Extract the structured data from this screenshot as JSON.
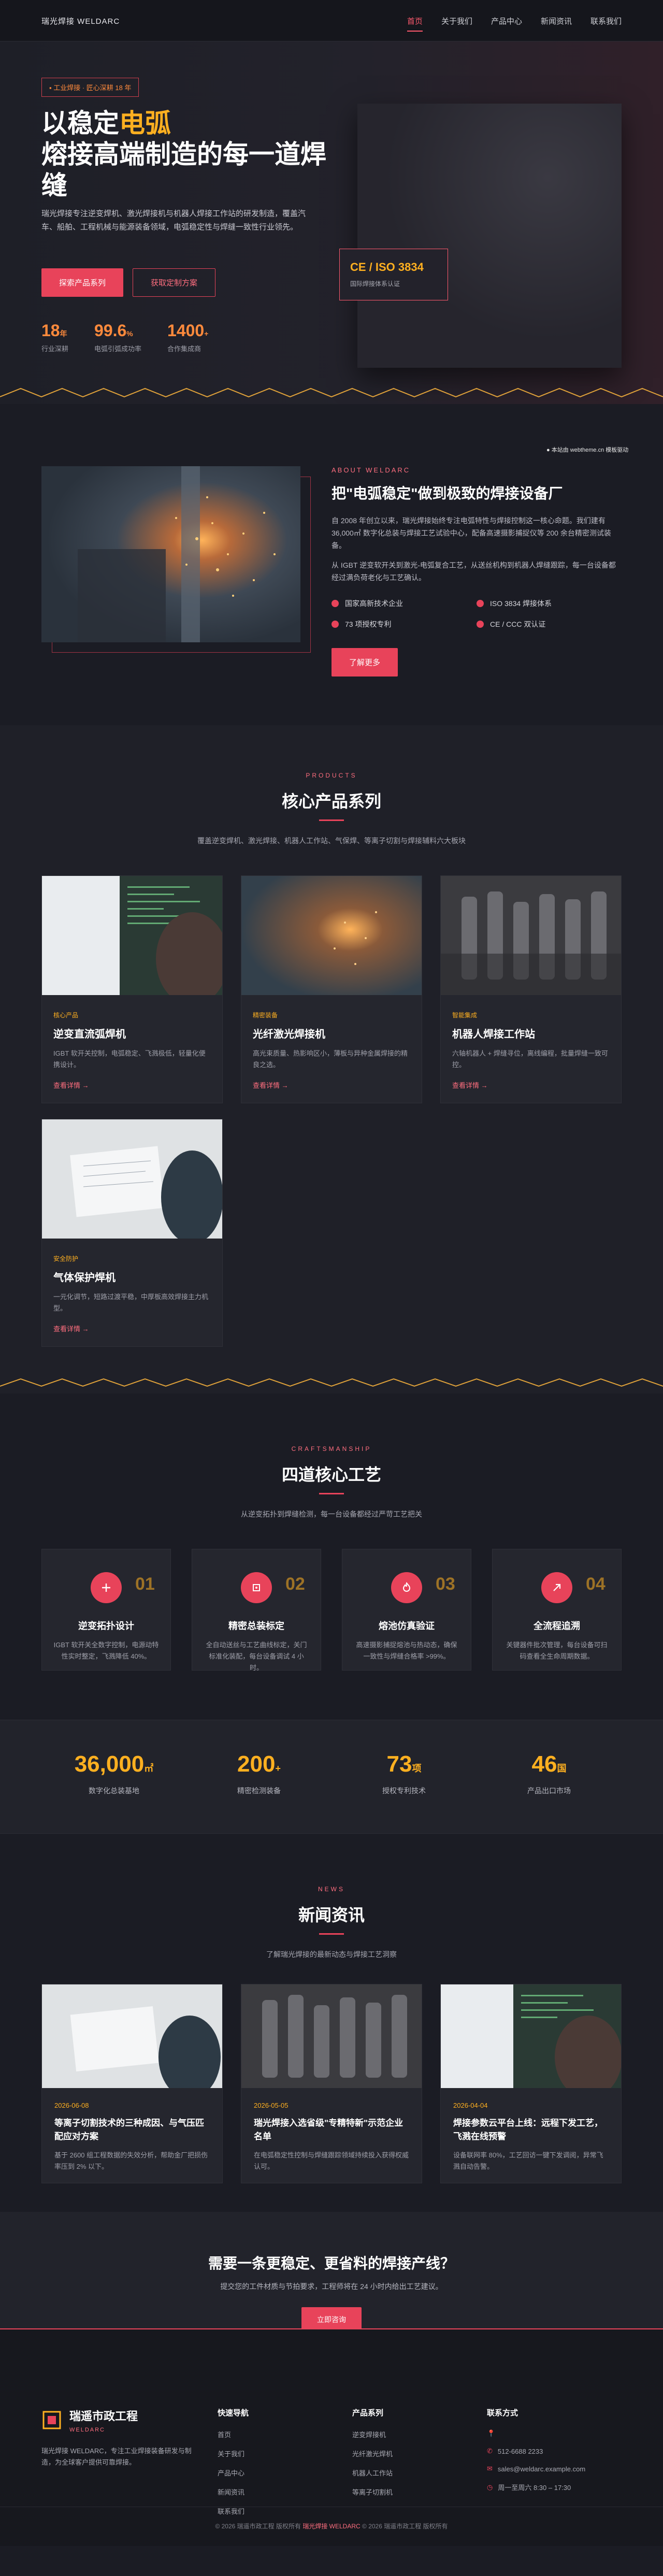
{
  "header": {
    "brand": "瑞光焊接 WELDARC",
    "nav": [
      "首页",
      "关于我们",
      "产品中心",
      "新闻资讯",
      "联系我们"
    ]
  },
  "hero": {
    "badge": "▪ 工业焊接 · 匠心深耕 18 年",
    "title_line1_a": "以稳定",
    "title_line1_b": "电弧",
    "title_line2": "熔接高端制造的每一道焊缝",
    "desc": "瑞光焊接专注逆变焊机、激光焊接机与机器人焊接工作站的研发制造，覆盖汽车、船舶、工程机械与能源装备领域，电弧稳定性与焊缝一致性行业领先。",
    "btn_primary": "探索产品系列",
    "btn_secondary": "获取定制方案",
    "stats": [
      {
        "num": "18",
        "unit": "年",
        "label": "行业深耕"
      },
      {
        "num": "99.6",
        "unit": "%",
        "label": "电弧引弧成功率"
      },
      {
        "num": "1400",
        "unit": "+",
        "label": "合作集成商"
      }
    ],
    "cert_title": "CE / ISO 3834",
    "cert_sub": "国际焊接体系认证"
  },
  "about": {
    "eyebrow": "ABOUT WELDARC",
    "title": "把\"电弧稳定\"做到极致的焊接设备厂",
    "p1": "自 2008 年创立以来，瑞光焊接始终专注电弧特性与焊接控制这一核心命题。我们建有 36,000㎡ 数字化总装与焊接工艺试验中心，配备高速摄影捕捉仪等 200 余台精密测试装备。",
    "p2": "从 IGBT 逆变软开关到激光-电弧复合工艺，从送丝机构到机器人焊缝跟踪，每一台设备都经过满负荷老化与工艺确认。",
    "list": [
      "国家高新技术企业",
      "ISO 3834 焊接体系",
      "73 项授权专利",
      "CE / CCC 双认证"
    ],
    "btn": "了解更多",
    "watermark": "● 本站由 webtheme.cn 模板驱动"
  },
  "products": {
    "eyebrow": "PRODUCTS",
    "title": "核心产品系列",
    "subtitle": "覆盖逆变焊机、激光焊接、机器人工作站、气保焊、等离子切割与焊接辅料六大板块",
    "items": [
      {
        "tag": "核心产品",
        "title": "逆变直流弧焊机",
        "desc": "IGBT 软开关控制，电弧稳定、飞溅极低，轻量化便携设计。",
        "more": "查看详情 →"
      },
      {
        "tag": "精密装备",
        "title": "光纤激光焊接机",
        "desc": "高光束质量、热影响区小，薄板与异种金属焊接的精良之选。",
        "more": "查看详情 →"
      },
      {
        "tag": "智能集成",
        "title": "机器人焊接工作站",
        "desc": "六轴机器人 + 焊缝寻位，离线编程，批量焊缝一致可控。",
        "more": "查看详情 →"
      },
      {
        "tag": "安全防护",
        "title": "气体保护焊机",
        "desc": "一元化调节，短路过渡平稳，中厚板高效焊接主力机型。",
        "more": "查看详情 →"
      }
    ]
  },
  "craft": {
    "eyebrow": "CRAFTSMANSHIP",
    "title": "四道核心工艺",
    "subtitle": "从逆变拓扑到焊缝检测，每一台设备都经过严苛工艺把关",
    "items": [
      {
        "num": "01",
        "title": "逆变拓扑设计",
        "desc": "IGBT 软开关全数字控制，电源动特性实时整定，飞溅降低 40%。",
        "icon": "plus-icon"
      },
      {
        "num": "02",
        "title": "精密总装标定",
        "desc": "全自动送丝与工艺曲线标定，关门标准化装配，每台设备调试 4 小时。",
        "icon": "target-icon"
      },
      {
        "num": "03",
        "title": "熔池仿真验证",
        "desc": "高速摄影捕捉熔池与热动态，确保一致性与焊缝合格率 >99%。",
        "icon": "flame-icon"
      },
      {
        "num": "04",
        "title": "全流程追溯",
        "desc": "关键器件批次管理，每台设备可扫码查看全生命周期数据。",
        "icon": "arrow-icon"
      }
    ]
  },
  "stats": [
    {
      "num": "36,000",
      "unit": "㎡",
      "label": "数字化总装基地"
    },
    {
      "num": "200",
      "unit": "+",
      "label": "精密检测装备"
    },
    {
      "num": "73",
      "unit": "项",
      "label": "授权专利技术"
    },
    {
      "num": "46",
      "unit": "国",
      "label": "产品出口市场"
    }
  ],
  "news": {
    "eyebrow": "NEWS",
    "title": "新闻资讯",
    "subtitle": "了解瑞光焊接的最新动态与焊接工艺洞察",
    "items": [
      {
        "date": "2026-06-08",
        "title": "等离子切割技术的三种成因、与气压匹配应对方案",
        "desc": "基于 2600 组工程数据的失效分析，帮助金厂把损伤率压到 2% 以下。"
      },
      {
        "date": "2026-05-05",
        "title": "瑞光焊接入选省级\"专精特新\"示范企业名单",
        "desc": "在电弧稳定性控制与焊缝跟踪领域持续投入获得权威认可。"
      },
      {
        "date": "2026-04-04",
        "title": "焊接参数云平台上线：远程下发工艺，飞溅在线预警",
        "desc": "设备联网率 80%，工艺回访一键下发调阅，异常飞溅自动告警。"
      }
    ]
  },
  "cta": {
    "title": "需要一条更稳定、更省料的焊接产线？",
    "desc": "提交您的工件材质与节拍要求，工程师将在 24 小时内给出工艺建议。",
    "btn": "立即咨询"
  },
  "footer": {
    "name": "瑞遥市政工程",
    "sub": "WELDARC",
    "desc": "瑞光焊接 WELDARC，专注工业焊接装备研发与制造，为全球客户提供可靠焊接。",
    "cols": [
      {
        "title": "快速导航",
        "items": [
          "首页",
          "关于我们",
          "产品中心",
          "新闻资讯",
          "联系我们"
        ]
      },
      {
        "title": "产品系列",
        "items": [
          "逆变焊接机",
          "光纤激光焊机",
          "机器人工作站",
          "等离子切割机"
        ]
      },
      {
        "title": "联系方式",
        "items": [
          "",
          "512-6688 2233",
          "sales@weldarc.example.com",
          "周一至周六 8:30 – 17:30"
        ]
      }
    ],
    "copyright_a": "© 2026 瑞遥市政工程 版权所有",
    "copyright_b": "瑞光焊接 WELDARC",
    "copyright_c": "© 2026 瑞遥市政工程 版权所有"
  }
}
